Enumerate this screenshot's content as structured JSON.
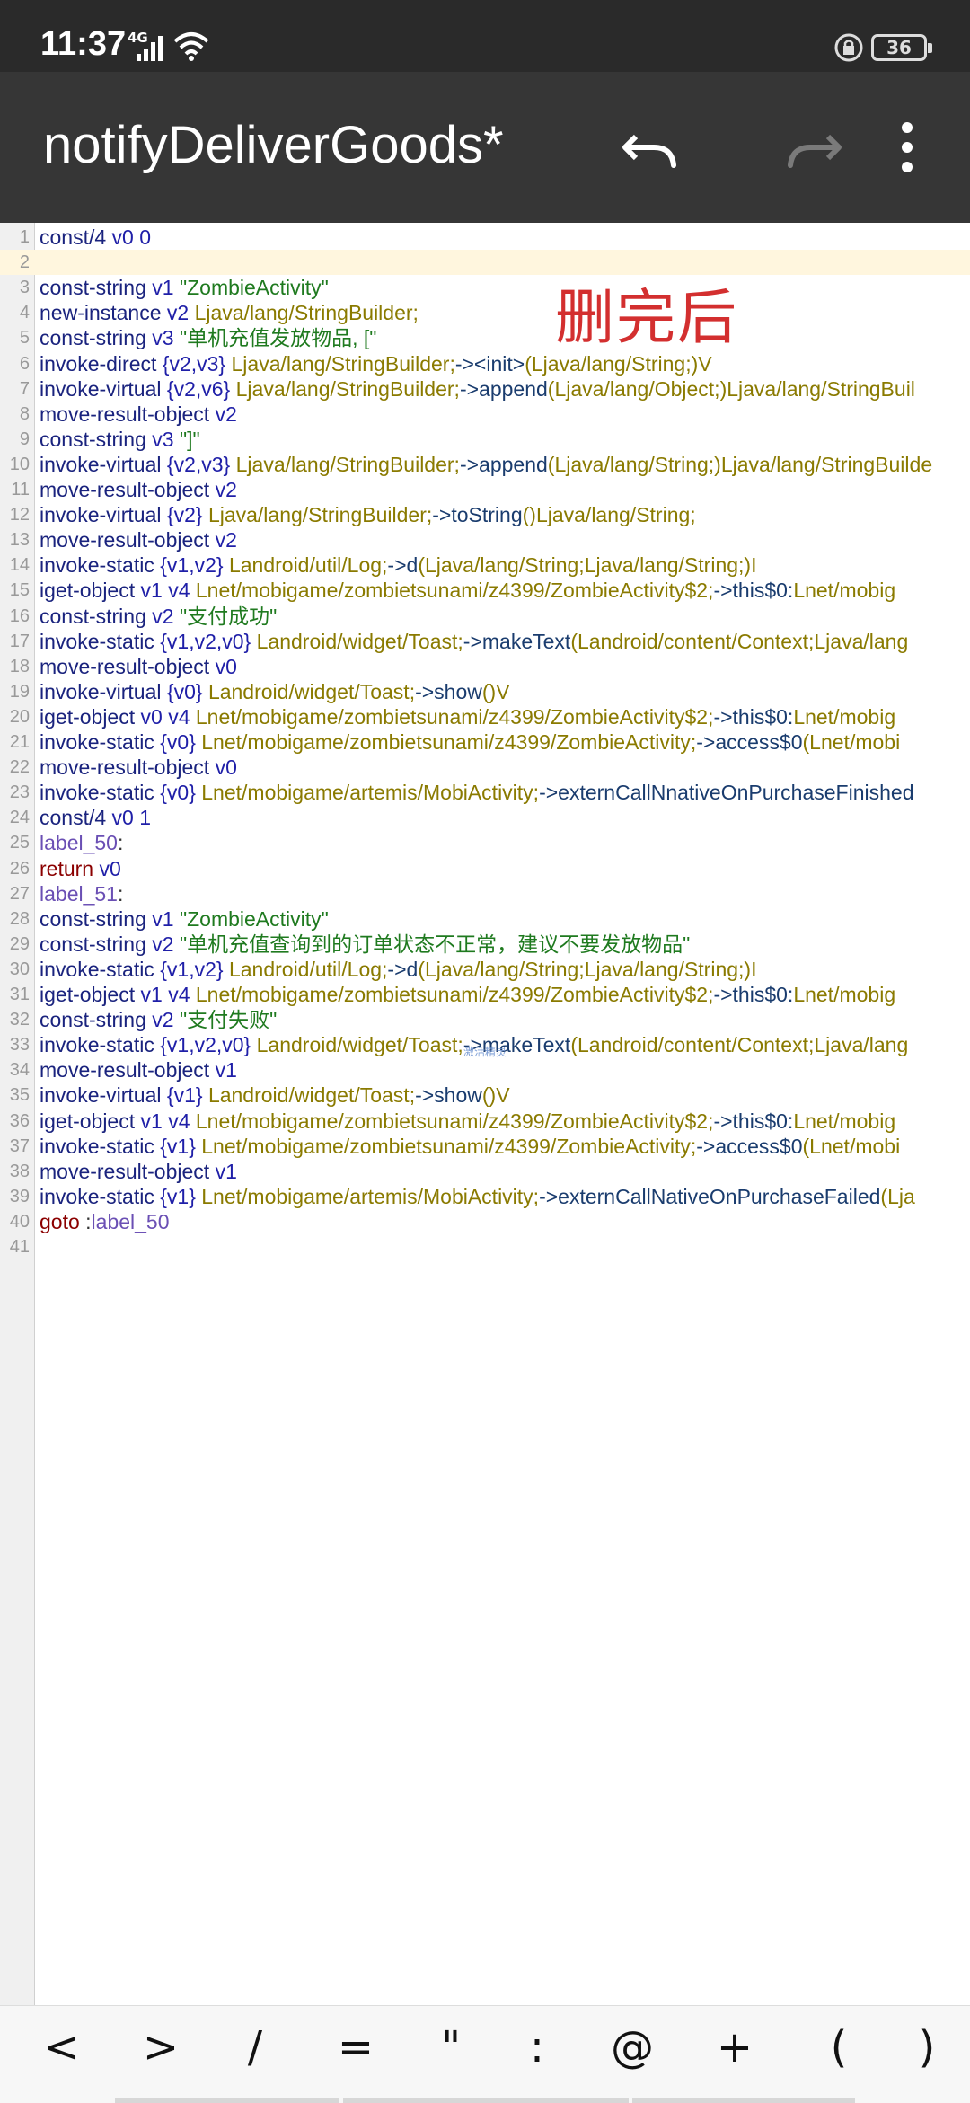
{
  "status_bar": {
    "time": "11:37",
    "network": "4G",
    "battery": "36"
  },
  "app_bar": {
    "title": "notifyDeliverGoods*",
    "undo_icon": "undo-icon",
    "redo_icon": "redo-icon",
    "menu_icon": "more-vert-icon"
  },
  "annotation": "删完后",
  "watermark": "激活精灵",
  "editor": {
    "current_line": 2,
    "lines": [
      {
        "n": "1",
        "tokens": [
          {
            "t": "const/4",
            "c": "kw"
          },
          {
            "t": "  v0  0",
            "c": "reg"
          }
        ]
      },
      {
        "n": "2",
        "tokens": []
      },
      {
        "n": "3",
        "tokens": [
          {
            "t": "const-string",
            "c": "kw"
          },
          {
            "t": "  v1 ",
            "c": "reg"
          },
          {
            "t": "\"ZombieActivity\"",
            "c": "str"
          }
        ]
      },
      {
        "n": "4",
        "tokens": [
          {
            "t": "new-instance",
            "c": "kw"
          },
          {
            "t": "  v2 ",
            "c": "reg"
          },
          {
            "t": " Ljava/lang/StringBuilder;",
            "c": "typ"
          }
        ]
      },
      {
        "n": "5",
        "tokens": [
          {
            "t": "const-string",
            "c": "kw"
          },
          {
            "t": "  v3 ",
            "c": "reg"
          },
          {
            "t": "\"单机充值发放物品, [\"",
            "c": "str"
          }
        ]
      },
      {
        "n": "6",
        "tokens": [
          {
            "t": "invoke-direct",
            "c": "kw"
          },
          {
            "t": "  {v2,v3} ",
            "c": "reg"
          },
          {
            "t": "Ljava/lang/StringBuilder;",
            "c": "typ"
          },
          {
            "t": "-><init>",
            "c": "meth"
          },
          {
            "t": "(Ljava/lang/String;)V",
            "c": "typ"
          }
        ]
      },
      {
        "n": "7",
        "tokens": [
          {
            "t": "invoke-virtual",
            "c": "kw"
          },
          {
            "t": "  {v2,v6} ",
            "c": "reg"
          },
          {
            "t": "Ljava/lang/StringBuilder;",
            "c": "typ"
          },
          {
            "t": "->append",
            "c": "meth"
          },
          {
            "t": "(Ljava/lang/Object;)Ljava/lang/StringBuil",
            "c": "typ"
          }
        ]
      },
      {
        "n": "8",
        "tokens": [
          {
            "t": "move-result-object",
            "c": "kw"
          },
          {
            "t": "  v2",
            "c": "reg"
          }
        ]
      },
      {
        "n": "9",
        "tokens": [
          {
            "t": "const-string",
            "c": "kw"
          },
          {
            "t": "  v3 ",
            "c": "reg"
          },
          {
            "t": "\"]\"",
            "c": "str"
          }
        ]
      },
      {
        "n": "10",
        "tokens": [
          {
            "t": "invoke-virtual",
            "c": "kw"
          },
          {
            "t": "  {v2,v3} ",
            "c": "reg"
          },
          {
            "t": "Ljava/lang/StringBuilder;",
            "c": "typ"
          },
          {
            "t": "->append",
            "c": "meth"
          },
          {
            "t": "(Ljava/lang/String;)Ljava/lang/StringBuilde",
            "c": "typ"
          }
        ]
      },
      {
        "n": "11",
        "tokens": [
          {
            "t": "move-result-object",
            "c": "kw"
          },
          {
            "t": "  v2",
            "c": "reg"
          }
        ]
      },
      {
        "n": "12",
        "tokens": [
          {
            "t": "invoke-virtual",
            "c": "kw"
          },
          {
            "t": "  {v2} ",
            "c": "reg"
          },
          {
            "t": "Ljava/lang/StringBuilder;",
            "c": "typ"
          },
          {
            "t": "->toString",
            "c": "meth"
          },
          {
            "t": "()Ljava/lang/String;",
            "c": "typ"
          }
        ]
      },
      {
        "n": "13",
        "tokens": [
          {
            "t": "move-result-object",
            "c": "kw"
          },
          {
            "t": "  v2",
            "c": "reg"
          }
        ]
      },
      {
        "n": "14",
        "tokens": [
          {
            "t": "invoke-static",
            "c": "kw"
          },
          {
            "t": "  {v1,v2} ",
            "c": "reg"
          },
          {
            "t": "Landroid/util/Log;",
            "c": "typ"
          },
          {
            "t": "->d",
            "c": "meth"
          },
          {
            "t": "(Ljava/lang/String;Ljava/lang/String;)I",
            "c": "typ"
          }
        ]
      },
      {
        "n": "15",
        "tokens": [
          {
            "t": "iget-object",
            "c": "kw"
          },
          {
            "t": "  v1  v4 ",
            "c": "reg"
          },
          {
            "t": "Lnet/mobigame/zombietsunami/z4399/ZombieActivity$2;",
            "c": "typ"
          },
          {
            "t": "->this$0:",
            "c": "meth"
          },
          {
            "t": "Lnet/mobig",
            "c": "typ"
          }
        ]
      },
      {
        "n": "16",
        "tokens": [
          {
            "t": "const-string",
            "c": "kw"
          },
          {
            "t": "  v2 ",
            "c": "reg"
          },
          {
            "t": "\"支付成功\"",
            "c": "str"
          }
        ]
      },
      {
        "n": "17",
        "tokens": [
          {
            "t": "invoke-static",
            "c": "kw"
          },
          {
            "t": "  {v1,v2,v0} ",
            "c": "reg"
          },
          {
            "t": "Landroid/widget/Toast;",
            "c": "typ"
          },
          {
            "t": "->makeText",
            "c": "meth"
          },
          {
            "t": "(Landroid/content/Context;Ljava/lang",
            "c": "typ"
          }
        ]
      },
      {
        "n": "18",
        "tokens": [
          {
            "t": "move-result-object",
            "c": "kw"
          },
          {
            "t": "  v0",
            "c": "reg"
          }
        ]
      },
      {
        "n": "19",
        "tokens": [
          {
            "t": "invoke-virtual",
            "c": "kw"
          },
          {
            "t": "  {v0} ",
            "c": "reg"
          },
          {
            "t": "Landroid/widget/Toast;",
            "c": "typ"
          },
          {
            "t": "->show",
            "c": "meth"
          },
          {
            "t": "()V",
            "c": "typ"
          }
        ]
      },
      {
        "n": "20",
        "tokens": [
          {
            "t": "iget-object",
            "c": "kw"
          },
          {
            "t": "  v0  v4 ",
            "c": "reg"
          },
          {
            "t": "Lnet/mobigame/zombietsunami/z4399/ZombieActivity$2;",
            "c": "typ"
          },
          {
            "t": "->this$0:",
            "c": "meth"
          },
          {
            "t": "Lnet/mobig",
            "c": "typ"
          }
        ]
      },
      {
        "n": "21",
        "tokens": [
          {
            "t": "invoke-static",
            "c": "kw"
          },
          {
            "t": "  {v0} ",
            "c": "reg"
          },
          {
            "t": "Lnet/mobigame/zombietsunami/z4399/ZombieActivity;",
            "c": "typ"
          },
          {
            "t": "->access$0",
            "c": "meth"
          },
          {
            "t": "(Lnet/mobi",
            "c": "typ"
          }
        ]
      },
      {
        "n": "22",
        "tokens": [
          {
            "t": "move-result-object",
            "c": "kw"
          },
          {
            "t": "  v0",
            "c": "reg"
          }
        ]
      },
      {
        "n": "23",
        "tokens": [
          {
            "t": "invoke-static",
            "c": "kw"
          },
          {
            "t": "  {v0} ",
            "c": "reg"
          },
          {
            "t": "Lnet/mobigame/artemis/MobiActivity;",
            "c": "typ"
          },
          {
            "t": "->externCallNnativeOnPurchaseFinished",
            "c": "meth"
          }
        ]
      },
      {
        "n": "24",
        "tokens": [
          {
            "t": "const/4",
            "c": "kw"
          },
          {
            "t": "  v0  1",
            "c": "reg"
          }
        ]
      },
      {
        "n": "25",
        "tokens": [
          {
            "t": "label_50",
            "c": "lab"
          },
          {
            "t": ":",
            "c": "pun"
          }
        ]
      },
      {
        "n": "26",
        "tokens": [
          {
            "t": "return",
            "c": "ret"
          },
          {
            "t": "  v0",
            "c": "reg"
          }
        ]
      },
      {
        "n": "27",
        "tokens": [
          {
            "t": "label_51",
            "c": "lab"
          },
          {
            "t": ":",
            "c": "pun"
          }
        ]
      },
      {
        "n": "28",
        "tokens": [
          {
            "t": "const-string",
            "c": "kw"
          },
          {
            "t": "  v1 ",
            "c": "reg"
          },
          {
            "t": "\"ZombieActivity\"",
            "c": "str"
          }
        ]
      },
      {
        "n": "29",
        "tokens": [
          {
            "t": "const-string",
            "c": "kw"
          },
          {
            "t": "  v2 ",
            "c": "reg"
          },
          {
            "t": "\"单机充值查询到的订单状态不正常，建议不要发放物品\"",
            "c": "str"
          }
        ]
      },
      {
        "n": "30",
        "tokens": [
          {
            "t": "invoke-static",
            "c": "kw"
          },
          {
            "t": "  {v1,v2} ",
            "c": "reg"
          },
          {
            "t": "Landroid/util/Log;",
            "c": "typ"
          },
          {
            "t": "->d",
            "c": "meth"
          },
          {
            "t": "(Ljava/lang/String;Ljava/lang/String;)I",
            "c": "typ"
          }
        ]
      },
      {
        "n": "31",
        "tokens": [
          {
            "t": "iget-object",
            "c": "kw"
          },
          {
            "t": "  v1  v4 ",
            "c": "reg"
          },
          {
            "t": "Lnet/mobigame/zombietsunami/z4399/ZombieActivity$2;",
            "c": "typ"
          },
          {
            "t": "->this$0:",
            "c": "meth"
          },
          {
            "t": "Lnet/mobig",
            "c": "typ"
          }
        ]
      },
      {
        "n": "32",
        "tokens": [
          {
            "t": "const-string",
            "c": "kw"
          },
          {
            "t": "  v2 ",
            "c": "reg"
          },
          {
            "t": "\"支付失败\"",
            "c": "str"
          }
        ]
      },
      {
        "n": "33",
        "tokens": [
          {
            "t": "invoke-static",
            "c": "kw"
          },
          {
            "t": "  {v1,v2,v0} ",
            "c": "reg"
          },
          {
            "t": "Landroid/widget/Toast;",
            "c": "typ"
          },
          {
            "t": "->makeText",
            "c": "meth"
          },
          {
            "t": "(Landroid/content/Context;Ljava/lang",
            "c": "typ"
          }
        ]
      },
      {
        "n": "34",
        "tokens": [
          {
            "t": "move-result-object",
            "c": "kw"
          },
          {
            "t": "  v1",
            "c": "reg"
          }
        ]
      },
      {
        "n": "35",
        "tokens": [
          {
            "t": "invoke-virtual",
            "c": "kw"
          },
          {
            "t": "  {v1} ",
            "c": "reg"
          },
          {
            "t": "Landroid/widget/Toast;",
            "c": "typ"
          },
          {
            "t": "->show",
            "c": "meth"
          },
          {
            "t": "()V",
            "c": "typ"
          }
        ]
      },
      {
        "n": "36",
        "tokens": [
          {
            "t": "iget-object",
            "c": "kw"
          },
          {
            "t": "  v1  v4 ",
            "c": "reg"
          },
          {
            "t": "Lnet/mobigame/zombietsunami/z4399/ZombieActivity$2;",
            "c": "typ"
          },
          {
            "t": "->this$0:",
            "c": "meth"
          },
          {
            "t": "Lnet/mobig",
            "c": "typ"
          }
        ]
      },
      {
        "n": "37",
        "tokens": [
          {
            "t": "invoke-static",
            "c": "kw"
          },
          {
            "t": "  {v1} ",
            "c": "reg"
          },
          {
            "t": "Lnet/mobigame/zombietsunami/z4399/ZombieActivity;",
            "c": "typ"
          },
          {
            "t": "->access$0",
            "c": "meth"
          },
          {
            "t": "(Lnet/mobi",
            "c": "typ"
          }
        ]
      },
      {
        "n": "38",
        "tokens": [
          {
            "t": "move-result-object",
            "c": "kw"
          },
          {
            "t": "  v1",
            "c": "reg"
          }
        ]
      },
      {
        "n": "39",
        "tokens": [
          {
            "t": "invoke-static",
            "c": "kw"
          },
          {
            "t": "  {v1} ",
            "c": "reg"
          },
          {
            "t": "Lnet/mobigame/artemis/MobiActivity;",
            "c": "typ"
          },
          {
            "t": "->externCallNativeOnPurchaseFailed",
            "c": "meth"
          },
          {
            "t": "(Lja",
            "c": "typ"
          }
        ]
      },
      {
        "n": "40",
        "tokens": [
          {
            "t": "goto",
            "c": "ret"
          },
          {
            "t": "  :",
            "c": "pun"
          },
          {
            "t": "label_50",
            "c": "lab"
          }
        ]
      },
      {
        "n": "41",
        "tokens": []
      }
    ]
  },
  "symbol_bar": {
    "keys": [
      "<",
      ">",
      "/",
      "=",
      "\"",
      ":",
      "@",
      "+",
      "(",
      ")"
    ]
  }
}
